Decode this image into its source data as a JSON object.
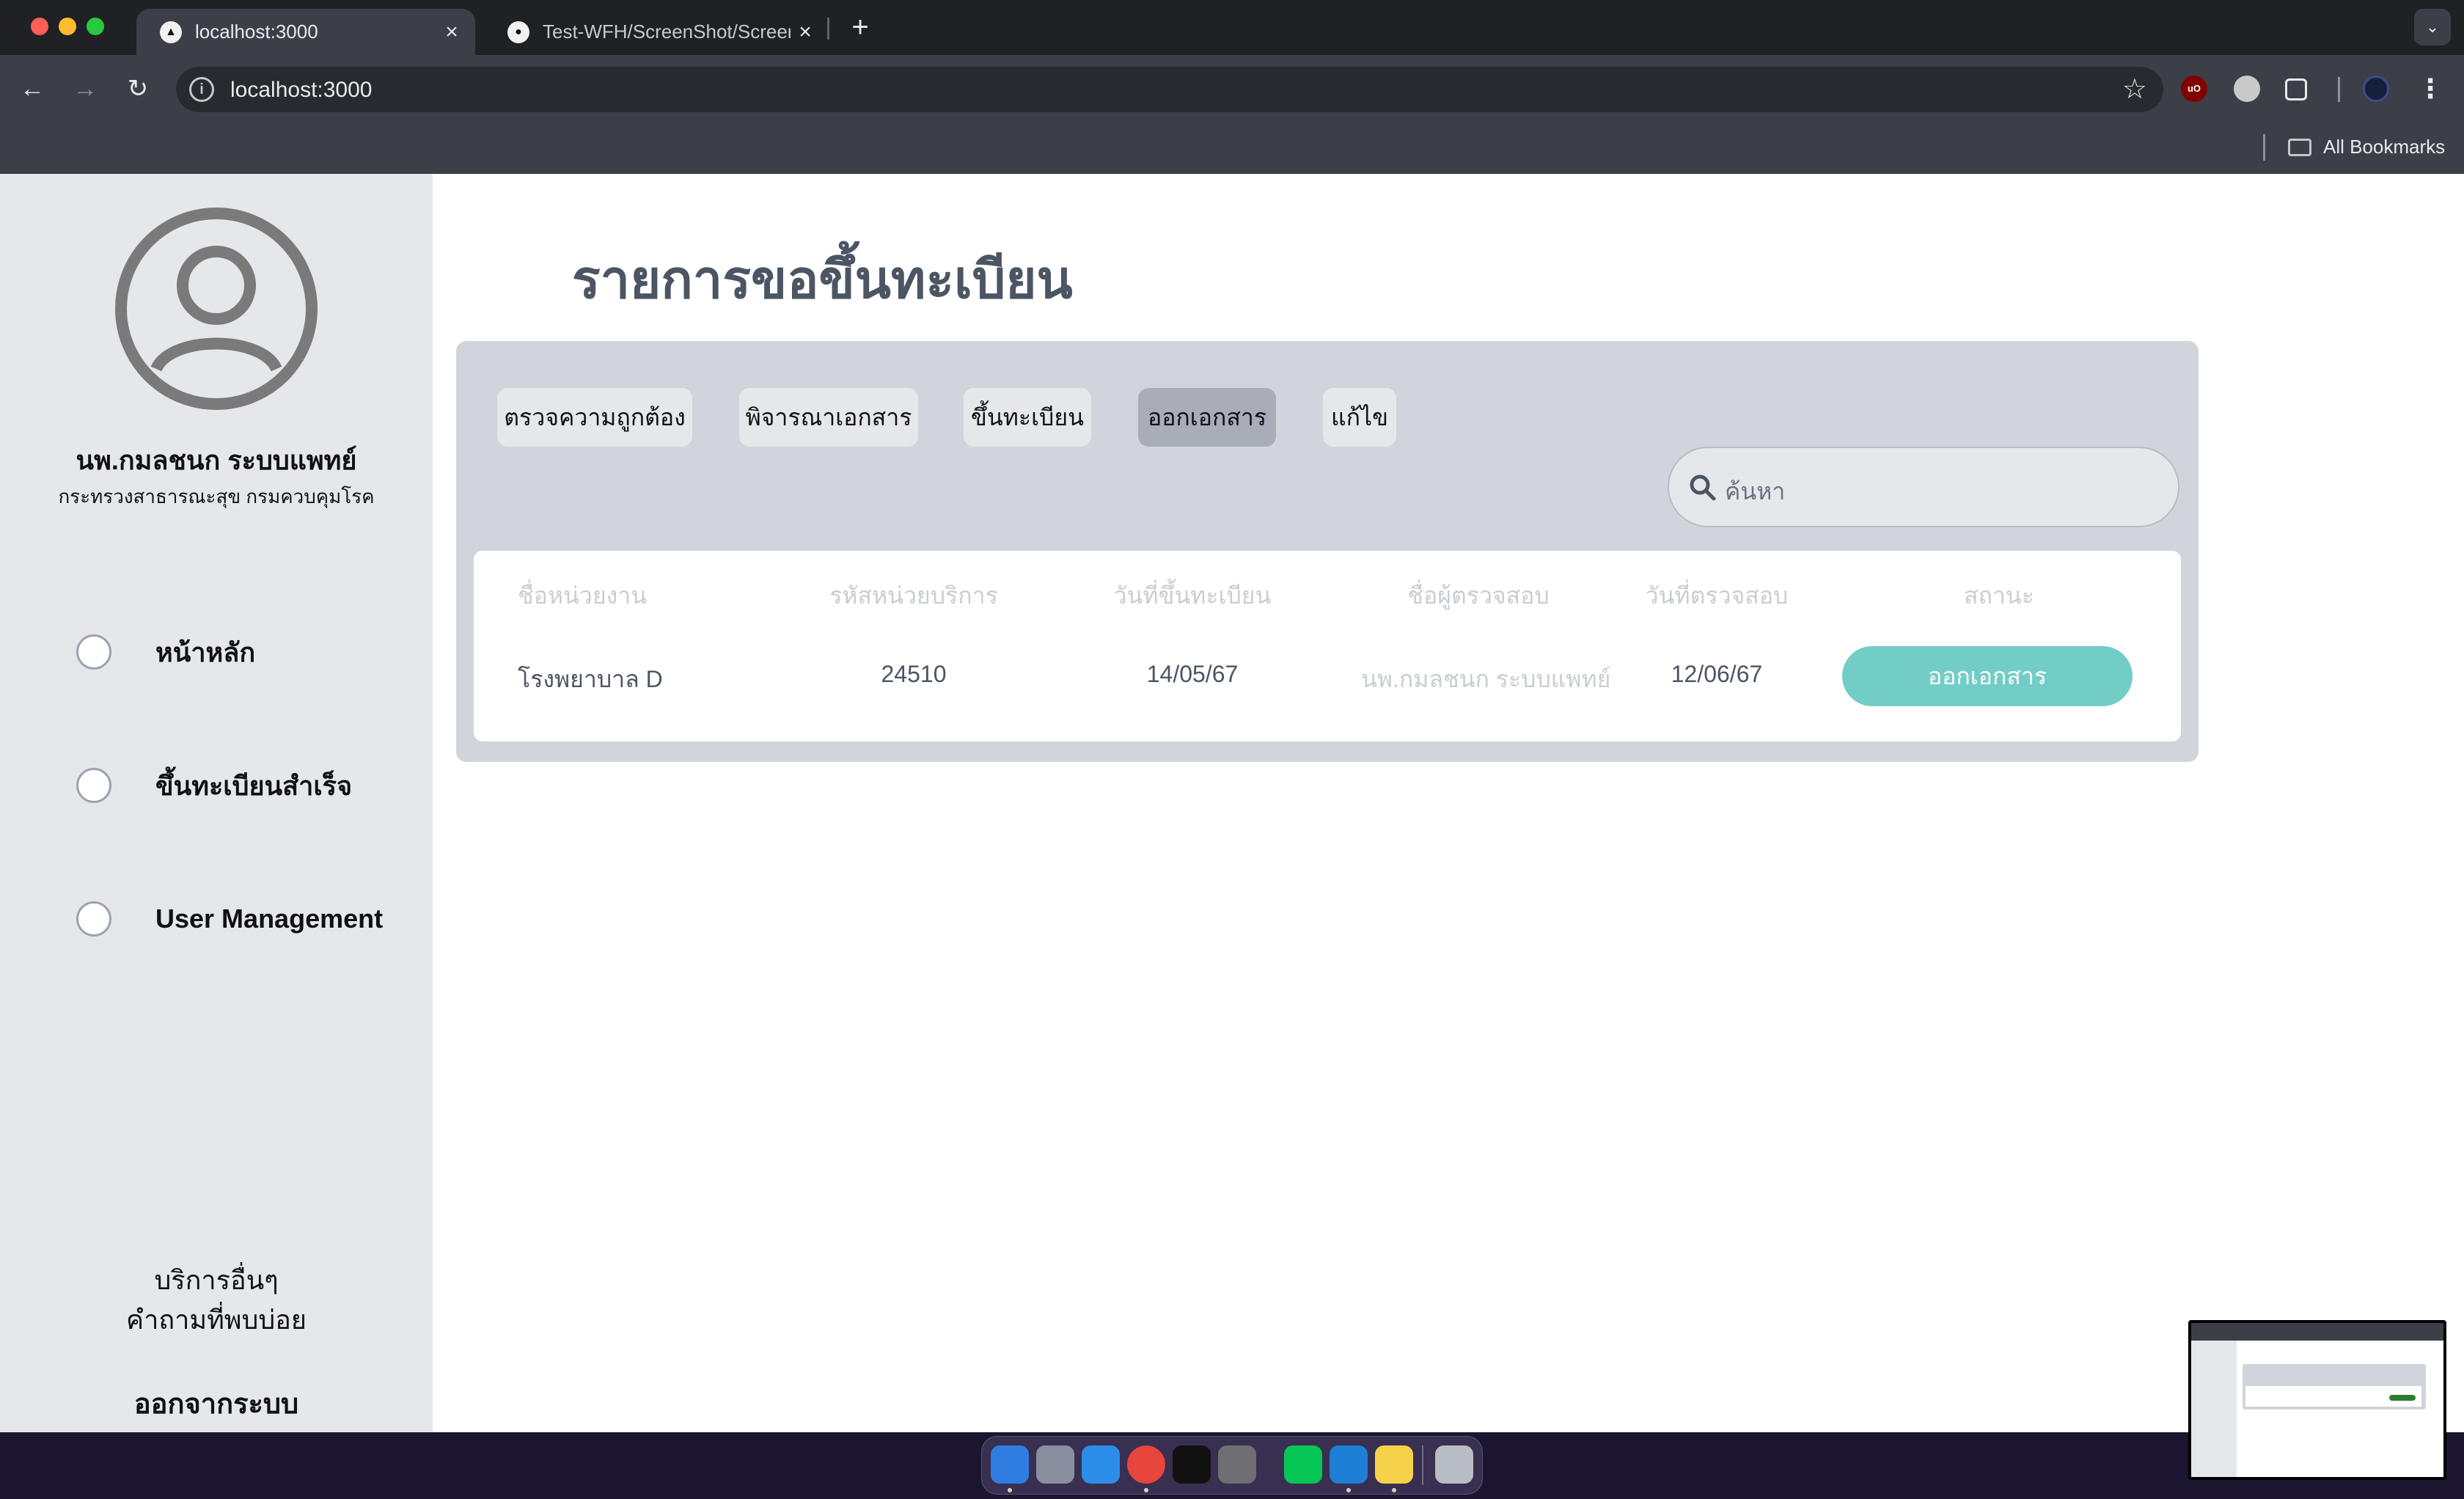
{
  "browser": {
    "tabs": [
      {
        "title": "localhost:3000",
        "active": true,
        "icon": "nextjs-triangle-icon"
      },
      {
        "title": "Test-WFH/ScreenShot/Screen",
        "active": false,
        "icon": "github-icon"
      }
    ],
    "new_tab_label": "+",
    "address": "localhost:3000",
    "bookmarks_label": "All Bookmarks"
  },
  "sidebar": {
    "user_name": "นพ.กมลชนก ระบบแพทย์",
    "user_org": "กระทรวงสาธารณะสุข กรมควบคุมโรค",
    "items": [
      {
        "label": "หน้าหลัก"
      },
      {
        "label": "ขึ้นทะเบียนสำเร็จ"
      },
      {
        "label": "User Management"
      }
    ],
    "footer_links": [
      "บริการอื่นๆ",
      "คำถามที่พบบ่อย"
    ],
    "logout_label": "ออกจากระบบ"
  },
  "main": {
    "title": "รายการขอขึ้นทะเบียน",
    "filters": [
      {
        "label": "ตรวจความถูกต้อง",
        "active": false
      },
      {
        "label": "พิจารณาเอกสาร",
        "active": false
      },
      {
        "label": "ขึ้นทะเบียน",
        "active": false
      },
      {
        "label": "ออกเอกสาร",
        "active": true
      },
      {
        "label": "แก้ไข",
        "active": false
      }
    ],
    "search_placeholder": "ค้นหา",
    "table": {
      "headers": [
        "ชื่อหน่วยงาน",
        "รหัสหน่วยบริการ",
        "วันที่ขึ้นทะเบียน",
        "ชื่อผู้ตรวจสอบ",
        "วันที่ตรวจสอบ",
        "สถานะ"
      ],
      "rows": [
        {
          "agency": "โรงพยาบาล D",
          "service_code": "24510",
          "registered_date": "14/05/67",
          "inspector": "นพ.กมลชนก ระบบแพทย์",
          "inspected_date": "12/06/67",
          "status": "ออกเอกสาร"
        }
      ]
    }
  },
  "colors": {
    "sidebar_bg": "#e5e7eb",
    "panel_bg": "#d1d5db",
    "status_accent": "#72cdc7",
    "active_filter": "#a9adb8"
  }
}
